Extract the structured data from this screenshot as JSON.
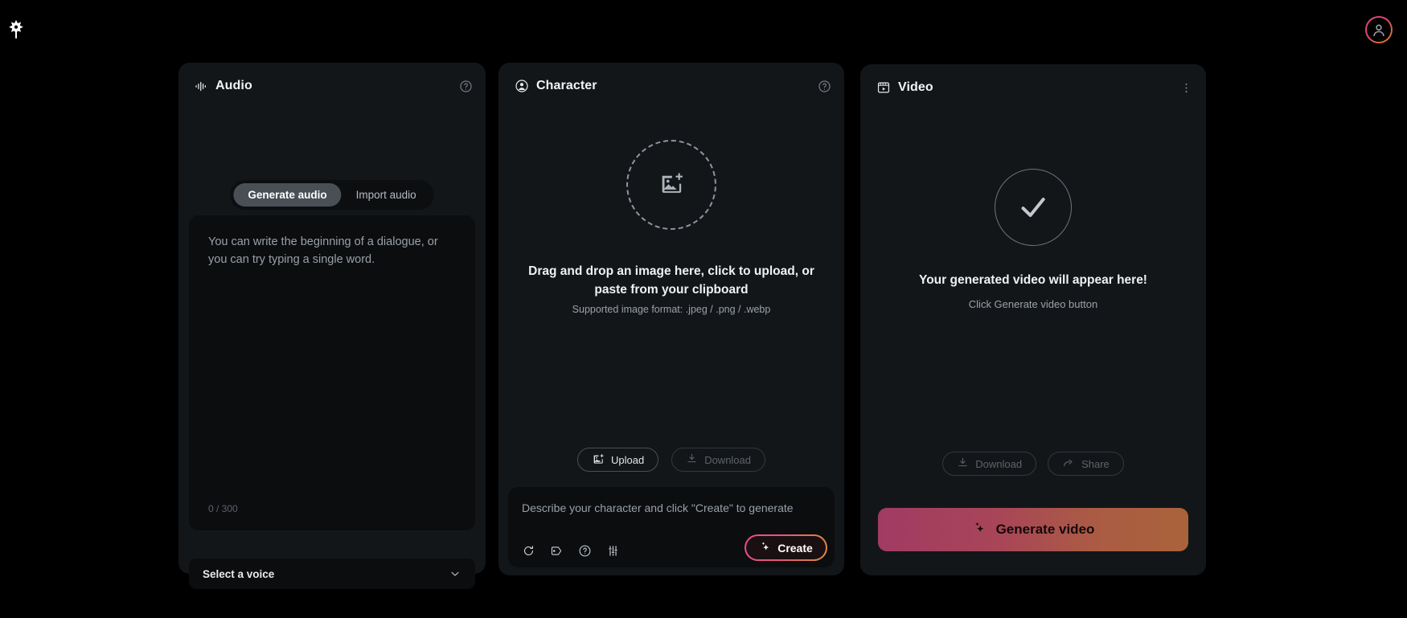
{
  "app": {
    "logo_icon": "snowflake-logo",
    "avatar_icon": "user-avatar-icon",
    "accent_pink": "#ee4b8c",
    "accent_orange": "#e08a3c",
    "panel_bg": "#131619",
    "page_bg": "#000000"
  },
  "audio_panel": {
    "title": "Audio",
    "title_icon": "audio-waveform-icon",
    "help_icon": "help-circle-icon",
    "tabs": [
      {
        "label": "Generate audio",
        "active": true
      },
      {
        "label": "Import audio",
        "active": false
      }
    ],
    "textarea_placeholder": "You can write the beginning of a dialogue, or you can try typing a single word.",
    "textarea_value": "",
    "char_count": "0 / 300",
    "voice_select_value": "Select a voice",
    "voice_chevron_icon": "chevron-down-icon"
  },
  "character_panel": {
    "title": "Character",
    "title_icon": "user-circle-icon",
    "help_icon": "help-circle-icon",
    "dropzone_icon": "image-add-icon",
    "dropzone_title": "Drag and drop an image here, click to upload, or paste from your clipboard",
    "dropzone_subtitle": "Supported image format: .jpeg / .png / .webp",
    "upload_label": "Upload",
    "upload_icon": "image-add-icon",
    "download_label": "Download",
    "download_icon": "download-icon",
    "download_disabled": true,
    "prompt_placeholder": "Describe your character and click \"Create\" to generate",
    "prompt_value": "",
    "tool_icons": [
      "refresh-icon",
      "tag-icon",
      "help-circle-icon",
      "sliders-icon"
    ],
    "create_label": "Create",
    "create_icon": "sparkles-icon"
  },
  "video_panel": {
    "title": "Video",
    "title_icon": "video-clapperboard-icon",
    "menu_icon": "more-vertical-icon",
    "status_icon": "check-circle-icon",
    "empty_title": "Your generated video will appear here!",
    "empty_subtitle": "Click Generate video button",
    "download_label": "Download",
    "download_icon": "download-icon",
    "download_disabled": true,
    "share_label": "Share",
    "share_icon": "share-icon",
    "share_disabled": true,
    "generate_label": "Generate video",
    "generate_icon": "sparkles-icon"
  }
}
